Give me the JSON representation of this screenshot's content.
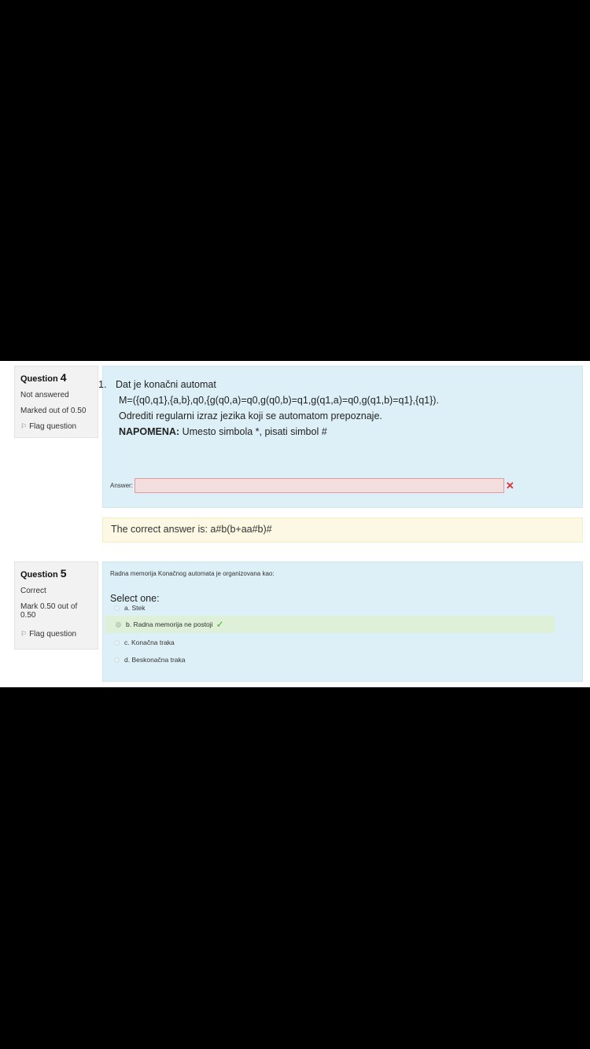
{
  "questions": [
    {
      "label": "Question",
      "number": "4",
      "status": "Not answered",
      "mark": "Marked out of 0.50",
      "flag_label": "Flag question",
      "list_marker": "1.",
      "text_lines": [
        "Dat je konačni automat",
        "M=({q0,q1},{a,b},q0,{g(q0,a)=q0,g(q0,b)=q1,g(q1,a)=q0,g(q1,b)=q1},{q1}).",
        "Odrediti regularni izraz jezika koji se automatom prepoznaje."
      ],
      "note_bold": "NAPOMENA:",
      "note_text": " Umesto simbola *, pisati simbol #",
      "answer_label": "Answer:",
      "answer_value": "",
      "incorrect_icon": "cross-icon",
      "feedback": "The correct answer is: a#b(b+aa#b)#"
    },
    {
      "label": "Question",
      "number": "5",
      "status": "Correct",
      "mark": "Mark 0.50 out of 0.50",
      "flag_label": "Flag question",
      "text": "Radna memorija Konačnog automata je organizovana kao:",
      "select_label": "Select one:",
      "options": [
        "a. Stek",
        "b. Radna memorija ne postoji",
        "c. Konačna traka",
        "d. Beskonačna traka"
      ],
      "selected_option": "b. Radna memorija ne postoji",
      "correct_icon": "checkmark-icon"
    }
  ]
}
